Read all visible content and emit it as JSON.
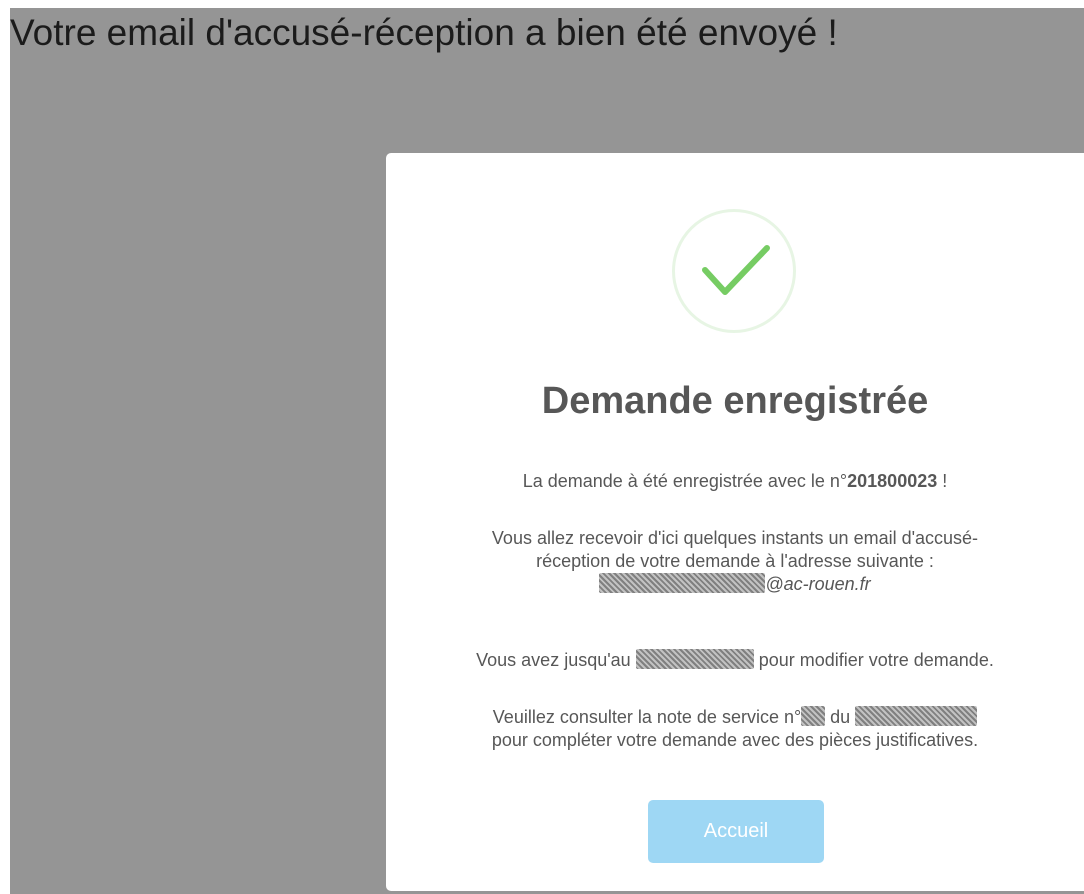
{
  "page": {
    "heading": "Votre email d'accusé-réception a bien été envoyé !"
  },
  "modal": {
    "icon": "check-icon",
    "title": "Demande enregistrée",
    "line1_prefix": "La demande à été enregistrée avec le n°",
    "request_number": "201800023",
    "line1_suffix": " !",
    "line2_a": "Vous allez recevoir d'ici quelques instants un email d'accusé-",
    "line2_b": "réception de votre demande à l'adresse suivante :",
    "email_domain": "@ac-rouen.fr",
    "line3_prefix": "Vous avez jusqu'au ",
    "line3_suffix": " pour modifier votre demande.",
    "line4_prefix": "Veuillez consulter la note de service n°",
    "line4_mid": " du ",
    "line4_b": "pour compléter votre demande avec des pièces justificatives.",
    "button_label": "Accueil"
  },
  "colors": {
    "backdrop": "#959595",
    "check": "#76cc63",
    "button": "#9ed7f4"
  }
}
